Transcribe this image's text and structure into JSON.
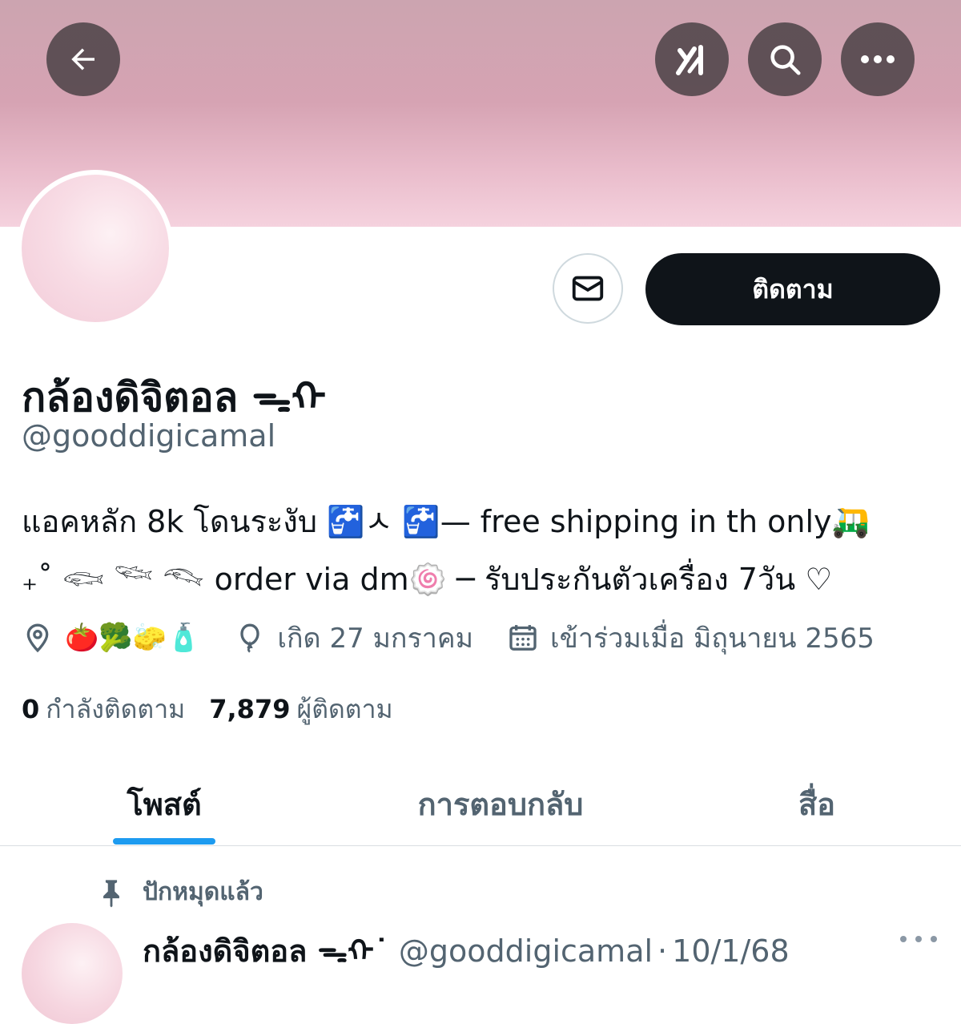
{
  "header": {
    "back_icon": "arrow-left-icon",
    "grok_icon": "grok-icon",
    "search_icon": "search-icon",
    "more_icon": "more-horizontal-icon"
  },
  "profile": {
    "display_name": "กล้องดิจิตอล ᯓᡣ",
    "handle": "@gooddigicamal",
    "follow_label": "ติดตาม",
    "message_icon": "envelope-icon",
    "bio_line_1": "แอคหลัก 8k โดนระงับ  🚰ㅅ 🚰— free shipping in th only🛺",
    "bio_line_2": "₊˚ 𓆟 𓆝 𓆞 order via dm🍥 ─ รับประกันตัวเครื่อง 7วัน ♡",
    "location": "🍅🥦🧽🧴",
    "birthday": "เกิด 27 มกราคม",
    "joined": "เข้าร่วมเมื่อ มิถุนายน 2565",
    "following_count": "0",
    "following_label": "กำลังติดตาม",
    "followers_count": "7,879",
    "followers_label": "ผู้ติดตาม"
  },
  "tabs": [
    {
      "label": "โพสต์",
      "active": true
    },
    {
      "label": "การตอบกลับ",
      "active": false
    },
    {
      "label": "สื่อ",
      "active": false
    }
  ],
  "post": {
    "pinned_label": "ปักหมุดแล้ว",
    "author_name": "กล้องดิจิตอล ᯓᡣ˙",
    "author_handle": "@gooddigicamal",
    "separator": "·",
    "date": "10/1/68"
  },
  "colors": {
    "accent": "#1d9bf0",
    "text_primary": "#0f1419",
    "text_secondary": "#536471",
    "banner": "#d6a3b3"
  }
}
